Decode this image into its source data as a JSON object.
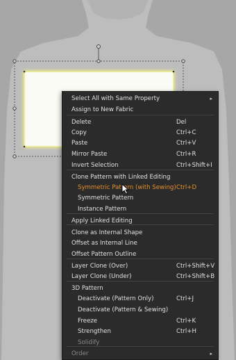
{
  "colors": {
    "background": "#a7a7a7",
    "avatar": "#bdbdbd",
    "menu_bg": "#2b2b2b",
    "menu_text": "#e2e2e2",
    "highlight": "#e8902c",
    "disabled": "#8a8a8a",
    "pattern_fill": "#fbfbf6",
    "pattern_glow": "#f3f389"
  },
  "menu": {
    "items": [
      {
        "label": "Select All with Same Property",
        "shortcut": "",
        "arrow": "▸",
        "style": "top"
      },
      {
        "label": "Assign to New Fabric",
        "shortcut": "",
        "arrow": "",
        "style": "top"
      },
      {
        "label": "Delete",
        "shortcut": "Del",
        "arrow": "",
        "style": "top"
      },
      {
        "label": "Copy",
        "shortcut": "Ctrl+C",
        "arrow": "",
        "style": "top"
      },
      {
        "label": "Paste",
        "shortcut": "Ctrl+V",
        "arrow": "",
        "style": "top"
      },
      {
        "label": "Mirror Paste",
        "shortcut": "Ctrl+R",
        "arrow": "",
        "style": "top"
      },
      {
        "label": "Invert Selection",
        "shortcut": "Ctrl+Shift+I",
        "arrow": "",
        "style": "top"
      },
      {
        "label": "Clone Pattern with Linked Editing",
        "shortcut": "",
        "arrow": "",
        "style": "top"
      },
      {
        "label": "Symmetric Pattern (with Sewing)",
        "shortcut": "Ctrl+D",
        "arrow": "",
        "style": "sub hl"
      },
      {
        "label": "Symmetric Pattern",
        "shortcut": "",
        "arrow": "",
        "style": "sub"
      },
      {
        "label": "Instance Pattern",
        "shortcut": "",
        "arrow": "",
        "style": "sub"
      },
      {
        "label": "Apply Linked Editing",
        "shortcut": "",
        "arrow": "",
        "style": "top"
      },
      {
        "label": "Clone as Internal Shape",
        "shortcut": "",
        "arrow": "",
        "style": "top"
      },
      {
        "label": "Offset as Internal Line",
        "shortcut": "",
        "arrow": "",
        "style": "top"
      },
      {
        "label": "Offset Pattern Outline",
        "shortcut": "",
        "arrow": "",
        "style": "top"
      },
      {
        "label": "Layer Clone (Over)",
        "shortcut": "Ctrl+Shift+V",
        "arrow": "",
        "style": "top"
      },
      {
        "label": "Layer Clone (Under)",
        "shortcut": "Ctrl+Shift+B",
        "arrow": "",
        "style": "top"
      },
      {
        "label": "3D Pattern",
        "shortcut": "",
        "arrow": "",
        "style": "top"
      },
      {
        "label": "Deactivate (Pattern Only)",
        "shortcut": "Ctrl+J",
        "arrow": "",
        "style": "sub"
      },
      {
        "label": "Deactivate (Pattern & Sewing)",
        "shortcut": "",
        "arrow": "",
        "style": "sub"
      },
      {
        "label": "Freeze",
        "shortcut": "Ctrl+K",
        "arrow": "",
        "style": "sub"
      },
      {
        "label": "Strengthen",
        "shortcut": "Ctrl+H",
        "arrow": "",
        "style": "sub"
      },
      {
        "label": "Solidify",
        "shortcut": "",
        "arrow": "",
        "style": "sub dim"
      },
      {
        "label": "Order",
        "shortcut": "",
        "arrow": "▸",
        "style": "top dim"
      }
    ]
  }
}
